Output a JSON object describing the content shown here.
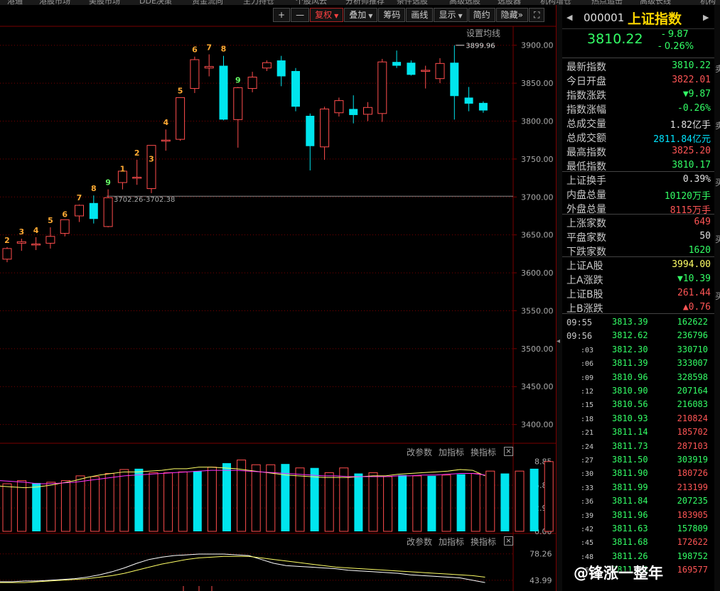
{
  "top_menu": [
    "港通",
    "港股市场",
    "美股市场",
    "DDE决策",
    "资金流向",
    "主力持仓",
    "个股风云",
    "分析师推荐",
    "条件选股",
    "高级选股",
    "选股器",
    "机构增仓",
    "热点追击",
    "高级长线",
    "机构"
  ],
  "toolbar": {
    "zoom_in": "+",
    "zoom_out": "—",
    "restore_rights": "复权",
    "overlay": "叠加",
    "chips": "筹码",
    "draw_line": "画线",
    "display": "显示",
    "simple": "简约",
    "hide": "隐藏",
    "collapse": "»",
    "fullscreen": "⛶",
    "ma_settings": "设置均线"
  },
  "main_chart": {
    "annotation_high": "3899.96",
    "annotation_line": "3702.26-3702.38",
    "y_ticks": [
      "3900.00",
      "3850.00",
      "3800.00",
      "3750.00",
      "3700.00",
      "3650.00",
      "3600.00",
      "3550.00",
      "3500.00",
      "3450.00",
      "3400.00"
    ],
    "sequence_labels_top": [
      "6",
      "7",
      "8",
      "9"
    ],
    "sequence_labels_rise": [
      "2",
      "3",
      "4",
      "5",
      "6",
      "7",
      "8",
      "9"
    ],
    "sequence_labels_mid": [
      "1",
      "2",
      "3",
      "4",
      "5"
    ]
  },
  "chart_data": {
    "type": "candlestick",
    "y_range": [
      3380,
      3925
    ],
    "reference_line": 3701,
    "candles": [
      {
        "o": 3618,
        "h": 3634,
        "l": 3614,
        "c": 3632
      },
      {
        "o": 3639,
        "h": 3645,
        "l": 3629,
        "c": 3641
      },
      {
        "o": 3638,
        "h": 3647,
        "l": 3630,
        "c": 3638
      },
      {
        "o": 3639,
        "h": 3660,
        "l": 3632,
        "c": 3648
      },
      {
        "o": 3652,
        "h": 3668,
        "l": 3648,
        "c": 3670
      },
      {
        "o": 3675,
        "h": 3690,
        "l": 3667,
        "c": 3689
      },
      {
        "o": 3692,
        "h": 3702,
        "l": 3665,
        "c": 3671
      },
      {
        "o": 3661,
        "h": 3710,
        "l": 3660,
        "c": 3699
      },
      {
        "o": 3719,
        "h": 3728,
        "l": 3710,
        "c": 3734
      },
      {
        "o": 3726,
        "h": 3749,
        "l": 3716,
        "c": 3726
      },
      {
        "o": 3711,
        "h": 3741,
        "l": 3705,
        "c": 3768
      },
      {
        "o": 3775,
        "h": 3789,
        "l": 3761,
        "c": 3775
      },
      {
        "o": 3776,
        "h": 3831,
        "l": 3774,
        "c": 3831
      },
      {
        "o": 3843,
        "h": 3885,
        "l": 3837,
        "c": 3881
      },
      {
        "o": 3870,
        "h": 3888,
        "l": 3859,
        "c": 3872
      },
      {
        "o": 3873,
        "h": 3886,
        "l": 3801,
        "c": 3802
      },
      {
        "o": 3802,
        "h": 3845,
        "l": 3765,
        "c": 3844
      },
      {
        "o": 3843,
        "h": 3865,
        "l": 3838,
        "c": 3858
      },
      {
        "o": 3870,
        "h": 3880,
        "l": 3866,
        "c": 3877
      },
      {
        "o": 3880,
        "h": 3886,
        "l": 3846,
        "c": 3859
      },
      {
        "o": 3866,
        "h": 3870,
        "l": 3813,
        "c": 3819
      },
      {
        "o": 3807,
        "h": 3810,
        "l": 3735,
        "c": 3767
      },
      {
        "o": 3766,
        "h": 3819,
        "l": 3749,
        "c": 3816
      },
      {
        "o": 3811,
        "h": 3831,
        "l": 3806,
        "c": 3827
      },
      {
        "o": 3816,
        "h": 3834,
        "l": 3797,
        "c": 3808
      },
      {
        "o": 3809,
        "h": 3825,
        "l": 3800,
        "c": 3818
      },
      {
        "o": 3810,
        "h": 3882,
        "l": 3799,
        "c": 3878
      },
      {
        "o": 3878,
        "h": 3893,
        "l": 3870,
        "c": 3873
      },
      {
        "o": 3877,
        "h": 3880,
        "l": 3860,
        "c": 3861
      },
      {
        "o": 3867,
        "h": 3873,
        "l": 3843,
        "c": 3867
      },
      {
        "o": 3856,
        "h": 3883,
        "l": 3850,
        "c": 3876
      },
      {
        "o": 3877,
        "h": 3900,
        "l": 3802,
        "c": 3833
      },
      {
        "o": 3831,
        "h": 3845,
        "l": 3813,
        "c": 3823
      },
      {
        "o": 3824,
        "h": 3826,
        "l": 3811,
        "c": 3814
      }
    ],
    "volume_panel": {
      "y_ticks": [
        "8.85",
        "5.82",
        "2.95",
        "0.00"
      ],
      "y_range": [
        0,
        9.5
      ],
      "values": [
        6.0,
        6.4,
        6.1,
        6.2,
        6.4,
        7.0,
        6.9,
        7.3,
        7.8,
        7.9,
        7.4,
        7.4,
        7.5,
        7.6,
        8.1,
        8.6,
        9.0,
        8.4,
        8.4,
        8.5,
        8.0,
        8.0,
        7.4,
        8.0,
        7.3,
        7.4,
        6.9,
        7.1,
        7.0,
        7.0,
        7.1,
        7.2,
        7.3,
        7.6,
        7.3,
        7.6,
        7.9,
        8.8,
        7.4,
        2.1
      ],
      "ma_short": [
        5.7,
        5.6,
        5.5,
        5.6,
        5.8,
        6.1,
        6.4,
        6.8,
        7.1,
        7.3,
        7.5,
        7.5,
        7.6,
        7.7,
        7.9,
        7.9,
        8.1,
        8.1,
        8.0,
        7.9,
        7.7,
        7.5,
        7.3,
        7.1,
        7.0,
        6.9,
        6.8,
        6.8,
        6.8,
        6.9,
        7.0,
        7.0,
        7.2,
        7.3,
        7.4,
        7.5,
        7.6,
        7.8,
        7.7,
        7.0
      ],
      "ma_long": [
        6.4,
        6.3,
        6.2,
        6.0,
        6.0,
        6.1,
        6.2,
        6.4,
        6.6,
        6.8,
        7.0,
        7.1,
        7.2,
        7.3,
        7.4,
        7.5,
        7.6,
        7.7,
        7.7,
        7.7,
        7.6,
        7.5,
        7.4,
        7.3,
        7.2,
        7.1,
        7.0,
        7.0,
        6.9,
        6.9,
        6.9,
        6.9,
        7.0,
        7.0,
        7.1,
        7.1,
        7.2,
        7.3,
        7.3,
        7.1
      ]
    },
    "indicator_panel": {
      "y_ticks": [
        "78.26",
        "43.99"
      ],
      "y_range": [
        30,
        90
      ],
      "line_white": [
        42,
        42,
        43,
        43,
        44,
        45,
        46,
        48,
        51,
        55,
        60,
        66,
        71,
        74,
        76,
        77,
        78,
        78,
        78,
        77,
        76,
        71,
        66,
        63,
        62,
        61,
        60,
        59,
        57,
        56,
        55,
        54,
        53,
        51,
        50,
        49,
        48,
        47,
        44,
        41
      ],
      "line_yellow": [
        41,
        41,
        41,
        42,
        43,
        44,
        45,
        46,
        48,
        50,
        53,
        57,
        61,
        65,
        68,
        71,
        73,
        74,
        75,
        75,
        75,
        73,
        71,
        69,
        67,
        65,
        63,
        61,
        60,
        59,
        58,
        57,
        56,
        55,
        54,
        53,
        52,
        51,
        50,
        48
      ]
    }
  },
  "panels": {
    "change_params": "改参数",
    "add_indicator": "加指标",
    "switch_indicator": "换指标",
    "close": "×"
  },
  "quote": {
    "code": "000001",
    "name": "上证指数",
    "price": "3810.22",
    "change": "- 9.87",
    "change_pct": "- 0.26%",
    "rows": [
      {
        "k": "最新指数",
        "v": "3810.22",
        "color": "#33ff66"
      },
      {
        "k": "今日开盘",
        "v": "3822.01",
        "color": "#ff5555"
      },
      {
        "k": "指数涨跌",
        "v": "▼9.87",
        "color": "#33ff66"
      },
      {
        "k": "指数涨幅",
        "v": "-0.26%",
        "color": "#33ff66"
      },
      {
        "k": "总成交量",
        "v": "1.82亿手",
        "color": "#e0e0e0"
      },
      {
        "k": "总成交额",
        "v": "2811.84亿元",
        "color": "#00e5ff"
      },
      {
        "k": "最高指数",
        "v": "3825.20",
        "color": "#ff5555"
      },
      {
        "k": "最低指数",
        "v": "3810.17",
        "color": "#33ff66"
      }
    ],
    "rows2": [
      {
        "k": "上证换手",
        "v": "0.39%",
        "color": "#e0e0e0"
      },
      {
        "k": "内盘总量",
        "v": "10120万手",
        "color": "#33ff66"
      },
      {
        "k": "外盘总量",
        "v": "8115万手",
        "color": "#ff5555"
      }
    ],
    "rows3": [
      {
        "k": "上涨家数",
        "v": "649",
        "color": "#ff5555"
      },
      {
        "k": "平盘家数",
        "v": "50",
        "color": "#e0e0e0"
      },
      {
        "k": "下跌家数",
        "v": "1620",
        "color": "#33ff66"
      }
    ],
    "rows4": [
      {
        "k": "上证A股",
        "v": "3994.00",
        "color": "#ffff66"
      },
      {
        "k": "上A涨跌",
        "v": "▼10.39",
        "color": "#33ff66"
      },
      {
        "k": "上证B股",
        "v": "261.44",
        "color": "#ff5555"
      },
      {
        "k": "上B涨跌",
        "v": "▲0.76",
        "color": "#ff5555"
      }
    ]
  },
  "ticks": [
    {
      "t": "09:55",
      "p": "3813.39",
      "v": "162622",
      "vc": "#33ff66",
      "big": true
    },
    {
      "t": "09:56",
      "p": "3812.62",
      "v": "236796",
      "vc": "#33ff66",
      "big": true
    },
    {
      "t": ":03",
      "p": "3812.30",
      "v": "330710",
      "vc": "#33ff66"
    },
    {
      "t": ":06",
      "p": "3811.39",
      "v": "333007",
      "vc": "#33ff66"
    },
    {
      "t": ":09",
      "p": "3810.96",
      "v": "328598",
      "vc": "#33ff66"
    },
    {
      "t": ":12",
      "p": "3810.90",
      "v": "207164",
      "vc": "#33ff66"
    },
    {
      "t": ":15",
      "p": "3810.56",
      "v": "216083",
      "vc": "#33ff66"
    },
    {
      "t": ":18",
      "p": "3810.93",
      "v": "210824",
      "vc": "#ff5555"
    },
    {
      "t": ":21",
      "p": "3811.14",
      "v": "185702",
      "vc": "#ff5555"
    },
    {
      "t": ":24",
      "p": "3811.73",
      "v": "287103",
      "vc": "#ff5555"
    },
    {
      "t": ":27",
      "p": "3811.50",
      "v": "303919",
      "vc": "#33ff66"
    },
    {
      "t": ":30",
      "p": "3811.90",
      "v": "180726",
      "vc": "#ff5555"
    },
    {
      "t": ":33",
      "p": "3811.99",
      "v": "213199",
      "vc": "#ff5555"
    },
    {
      "t": ":36",
      "p": "3811.84",
      "v": "207235",
      "vc": "#33ff66"
    },
    {
      "t": ":39",
      "p": "3811.96",
      "v": "183905",
      "vc": "#ff5555"
    },
    {
      "t": ":42",
      "p": "3811.63",
      "v": "157809",
      "vc": "#33ff66"
    },
    {
      "t": ":45",
      "p": "3811.68",
      "v": "172622",
      "vc": "#ff5555"
    },
    {
      "t": ":48",
      "p": "3811.26",
      "v": "198752",
      "vc": "#33ff66"
    },
    {
      "t": ":51",
      "p": "3811.05",
      "v": "169577",
      "vc": "#ff5555"
    }
  ],
  "edge_strip": [
    "卖",
    "卖",
    "买",
    "买",
    "买"
  ],
  "watermark": "@锋涨一整年",
  "colors": {
    "up": "#ff4d4d",
    "down": "#00e5ee",
    "grid": "#7a0000",
    "up_text": "#ff5555",
    "down_text": "#33ff66",
    "seq_orange": "#ffaa33",
    "seq_green": "#66ff66"
  }
}
